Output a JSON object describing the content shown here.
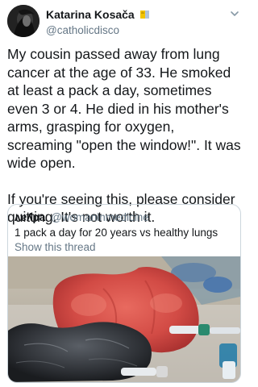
{
  "tweet": {
    "author": {
      "display_name": "Katarina Kosača",
      "handle": "@catholicdisco",
      "avatar_icon": "profile-avatar",
      "badge_icon": "crown-flag-icon",
      "badge_colors": [
        "#f2c400",
        "#b0c4de"
      ]
    },
    "menu_icon": "chevron-down-icon",
    "paragraphs": [
      "My cousin passed away from lung cancer at the age of 33. He smoked at least a pack a day, sometimes even 3 or 4. He died in his mother's arms, grasping for oxygen, screaming \"open the window!\". It was wide open.",
      "If you're seeing this, please consider quitting. It's not worth it."
    ],
    "quote": {
      "display_name": "ʌɐʎpa",
      "handle": "@womaninmedicine",
      "text": "1 pack a day for 20 years vs healthy lungs",
      "show_thread": "Show this thread",
      "image_description_icon": "lungs-photo"
    }
  },
  "colors": {
    "text": "#14171a",
    "secondary": "#657786",
    "border": "#ccd6dd",
    "healthy_lung": "#d8554f",
    "smoker_lung": "#3a3d42"
  }
}
